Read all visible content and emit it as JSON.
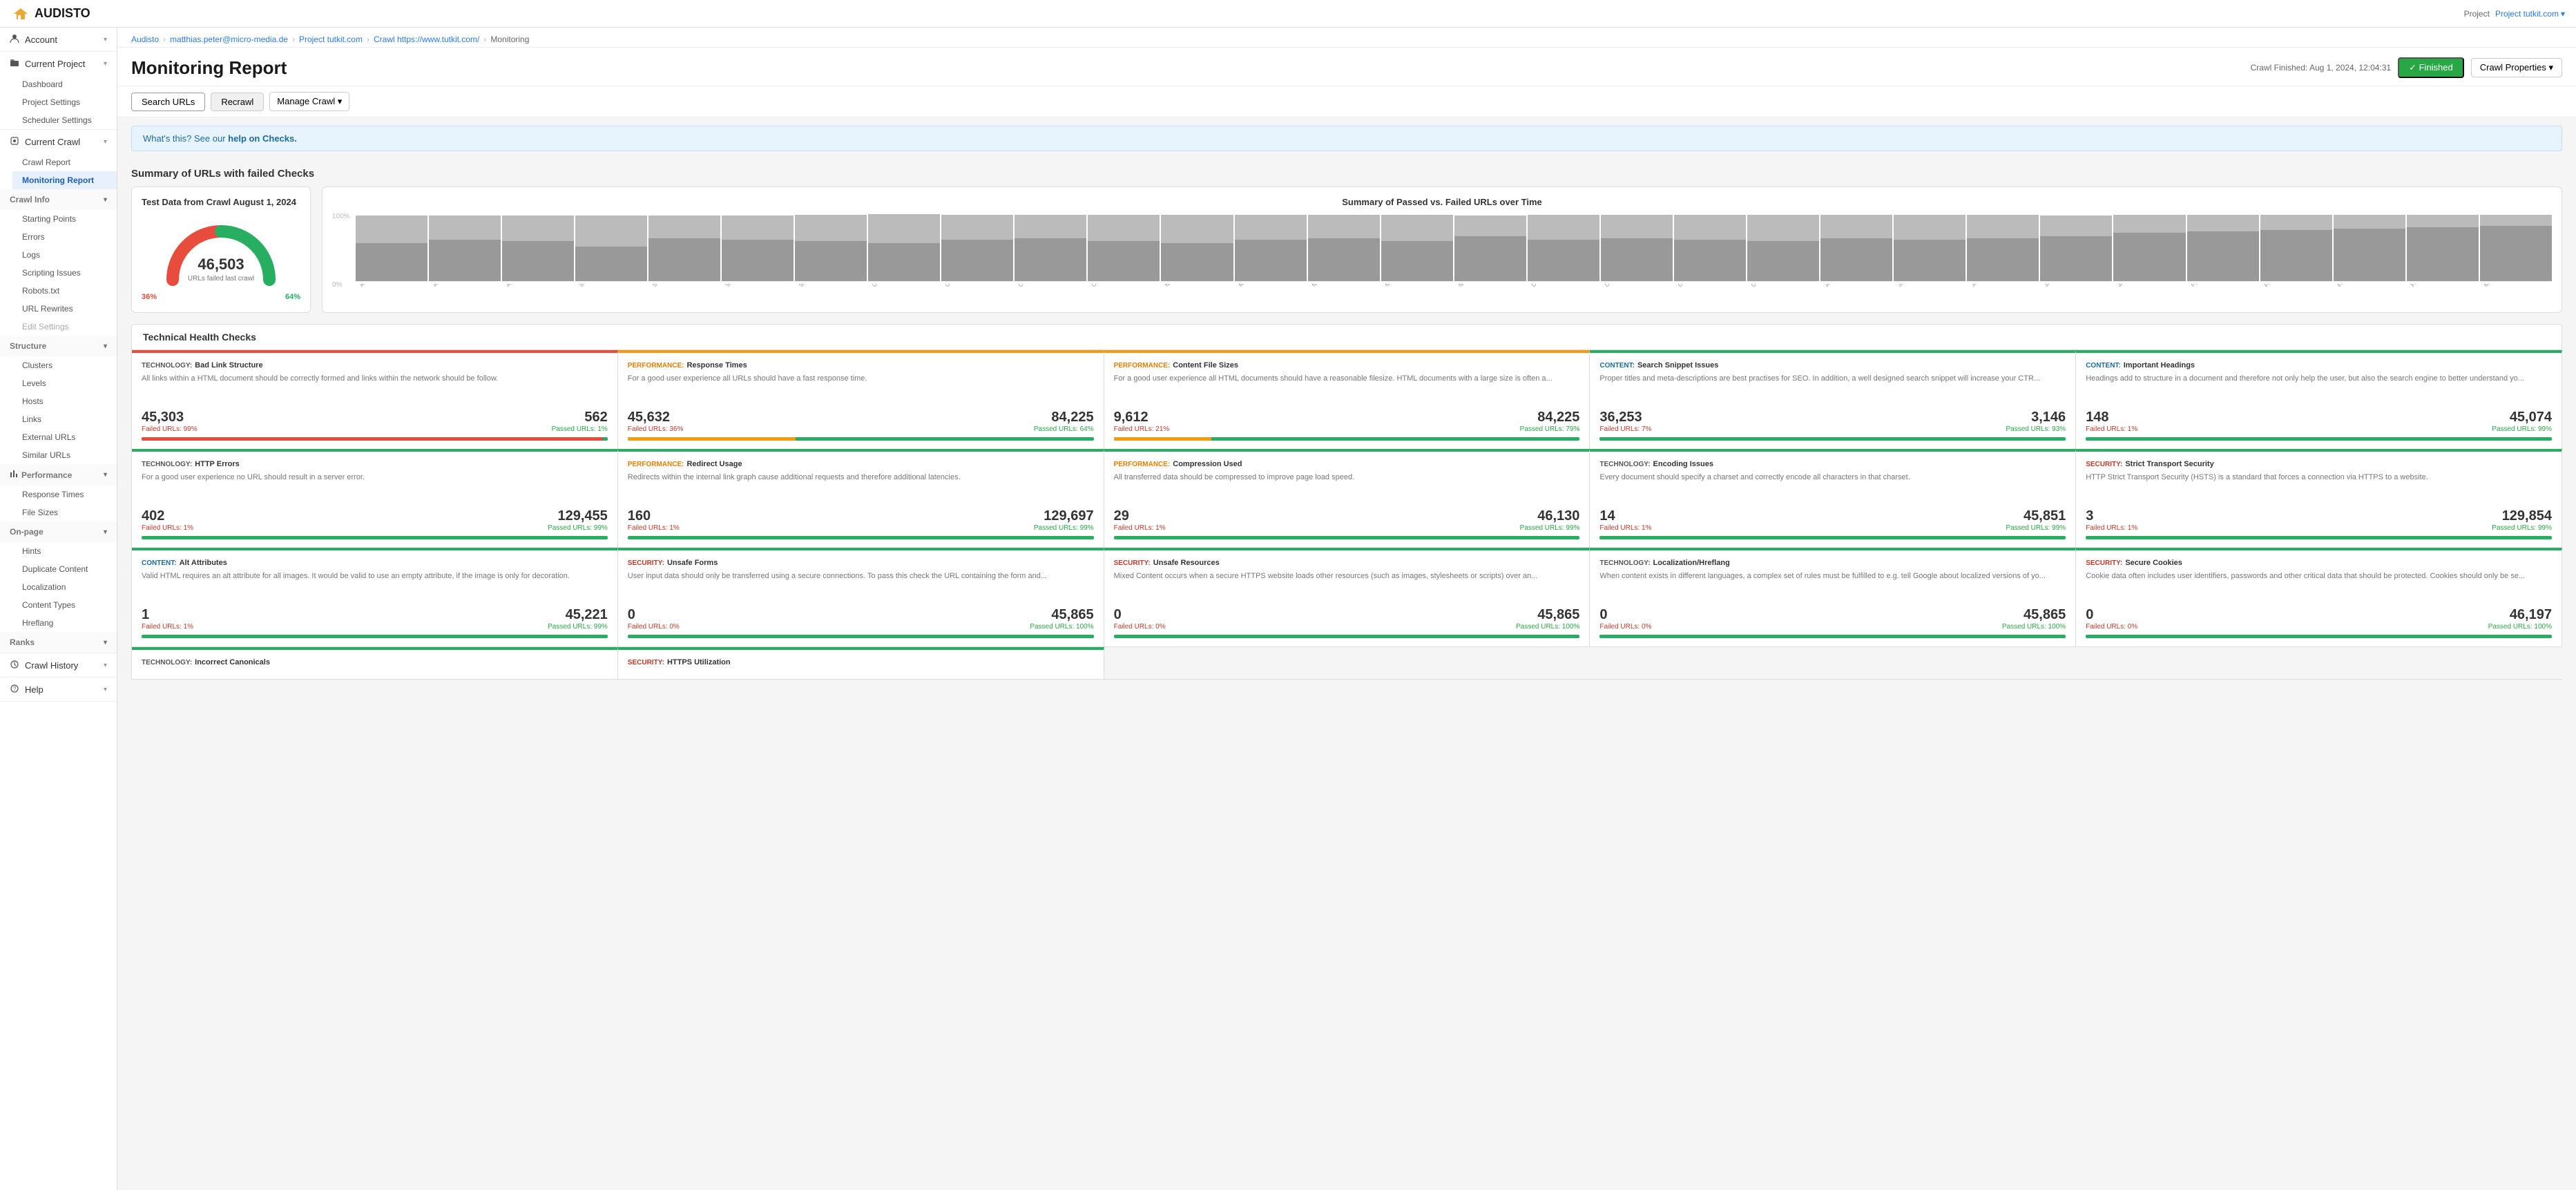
{
  "topNav": {
    "logo": "AUDISTO",
    "projectLabel": "Project",
    "projectName": "Project tutkit.com",
    "projectDropdown": "▾"
  },
  "breadcrumb": [
    {
      "label": "Audisto",
      "link": true
    },
    {
      "label": "matthias.peter@micro-media.de",
      "link": true
    },
    {
      "label": "Project tutkit.com",
      "link": true
    },
    {
      "label": "Crawl https://www.tutkit.com/",
      "link": true
    },
    {
      "label": "Monitoring",
      "link": false
    }
  ],
  "page": {
    "title": "Monitoring Report",
    "crawlFinished": "Crawl Finished: Aug 1, 2024, 12:04:31",
    "finishedBadge": "✓ Finished",
    "crawlPropsBtn": "Crawl Properties ▾"
  },
  "toolbar": {
    "searchUrls": "Search URLs",
    "recrawl": "Recrawl",
    "manageCrawl": "Manage Crawl ▾"
  },
  "infoBanner": {
    "text": "What's this? See our ",
    "linkText": "help on Checks.",
    "suffix": ""
  },
  "summary": {
    "sectionTitle": "Summary of URLs with failed Checks",
    "gaugeCard": {
      "title": "Test Data from Crawl August 1, 2024",
      "number": "46,503",
      "label": "URLs failed last crawl",
      "pctLeft": "36%",
      "pctRight": "64%",
      "redDeg": 130,
      "greenDeg": 360
    },
    "barChart": {
      "title": "Summary of Passed vs. Failed URLs over Time",
      "yLabels": [
        "100%",
        "0%"
      ],
      "bars": [
        {
          "label": "Aug 16",
          "fail": 55,
          "pass": 40
        },
        {
          "label": "Aug 23",
          "fail": 60,
          "pass": 35
        },
        {
          "label": "Aug 30",
          "fail": 58,
          "pass": 37
        },
        {
          "label": "Sep 6",
          "fail": 50,
          "pass": 45
        },
        {
          "label": "Sep 13",
          "fail": 62,
          "pass": 33
        },
        {
          "label": "Sep 20",
          "fail": 60,
          "pass": 35
        },
        {
          "label": "Sep 27",
          "fail": 58,
          "pass": 38
        },
        {
          "label": "Oct 4",
          "fail": 55,
          "pass": 42
        },
        {
          "label": "Oct 11",
          "fail": 60,
          "pass": 36
        },
        {
          "label": "Oct 18",
          "fail": 62,
          "pass": 34
        },
        {
          "label": "Oct 25",
          "fail": 58,
          "pass": 38
        },
        {
          "label": "Nov 1",
          "fail": 55,
          "pass": 41
        },
        {
          "label": "Nov 8",
          "fail": 60,
          "pass": 36
        },
        {
          "label": "Nov 15",
          "fail": 62,
          "pass": 34
        },
        {
          "label": "Nov 22",
          "fail": 58,
          "pass": 38
        },
        {
          "label": "Nov 29",
          "fail": 65,
          "pass": 30
        },
        {
          "label": "Dec 6",
          "fail": 60,
          "pass": 36
        },
        {
          "label": "Dec 13",
          "fail": 62,
          "pass": 34
        },
        {
          "label": "Dec 20",
          "fail": 60,
          "pass": 36
        },
        {
          "label": "Dec 27",
          "fail": 58,
          "pass": 38
        },
        {
          "label": "Jan 3",
          "fail": 62,
          "pass": 34
        },
        {
          "label": "Jan 10",
          "fail": 60,
          "pass": 36
        },
        {
          "label": "Jan 17",
          "fail": 62,
          "pass": 34
        },
        {
          "label": "Jan 24",
          "fail": 65,
          "pass": 30
        },
        {
          "label": "Jan 31",
          "fail": 70,
          "pass": 26
        },
        {
          "label": "Feb 7",
          "fail": 72,
          "pass": 24
        },
        {
          "label": "Feb 14",
          "fail": 74,
          "pass": 22
        },
        {
          "label": "Feb 21",
          "fail": 76,
          "pass": 20
        },
        {
          "label": "Feb 28",
          "fail": 78,
          "pass": 18
        },
        {
          "label": "Mar 7",
          "fail": 80,
          "pass": 16
        }
      ]
    }
  },
  "techHealth": {
    "sectionTitle": "Technical Health Checks",
    "cards": [
      {
        "category": "TECHNOLOGY",
        "categoryClass": "cat-tech",
        "name": "Bad Link Structure",
        "desc": "All links within a HTML document should be correctly formed and links within the network should be follow.",
        "failCount": "45,303",
        "passCount": "562",
        "failPct": "Failed URLs: 99%",
        "passPct": "Passed URLs: 1%",
        "failBar": 99,
        "statusColor": "red"
      },
      {
        "category": "PERFORMANCE",
        "categoryClass": "cat-perf",
        "name": "Response Times",
        "desc": "For a good user experience all URLs should have a fast response time.",
        "failCount": "45,632",
        "passCount": "84,225",
        "failPct": "Failed URLs: 36%",
        "passPct": "Passed URLs: 64%",
        "failBar": 36,
        "statusColor": "yellow"
      },
      {
        "category": "PERFORMANCE",
        "categoryClass": "cat-perf",
        "name": "Content File Sizes",
        "desc": "For a good user experience all HTML documents should have a reasonable filesize. HTML documents with a large size is often a...",
        "failCount": "9,612",
        "passCount": "84,225",
        "failPct": "Failed URLs: 21%",
        "passPct": "Passed URLs: 79%",
        "failBar": 21,
        "statusColor": "yellow"
      },
      {
        "category": "CONTENT",
        "categoryClass": "cat-content",
        "name": "Search Snippet Issues",
        "desc": "Proper titles and meta-descriptions are best practises for SEO. In addition, a well designed search snippet will increase your CTR...",
        "failCount": "36,253",
        "passCount": "3,146",
        "failPct": "Failed URLs: 7%",
        "passPct": "Passed URLs: 93%",
        "failBar": 7,
        "statusColor": "green"
      },
      {
        "category": "CONTENT",
        "categoryClass": "cat-content",
        "name": "Important Headings",
        "desc": "Headings add to structure in a document and therefore not only help the user, but also the search engine to better understand yo...",
        "failCount": "148",
        "passCount": "45,074",
        "failPct": "Failed URLs: 1%",
        "passPct": "Passed URLs: 99%",
        "failBar": 1,
        "statusColor": "green"
      },
      {
        "category": "TECHNOLOGY",
        "categoryClass": "cat-tech",
        "name": "HTTP Errors",
        "desc": "For a good user experience no URL should result in a server error.",
        "failCount": "402",
        "passCount": "129,455",
        "failPct": "Failed URLs: 1%",
        "passPct": "Passed URLs: 99%",
        "failBar": 1,
        "statusColor": "green"
      },
      {
        "category": "PERFORMANCE",
        "categoryClass": "cat-perf",
        "name": "Redirect Usage",
        "desc": "Redirects within the internal link graph cause additional requests and therefore additional latencies.",
        "failCount": "160",
        "passCount": "129,697",
        "failPct": "Failed URLs: 1%",
        "passPct": "Passed URLs: 99%",
        "failBar": 1,
        "statusColor": "green"
      },
      {
        "category": "PERFORMANCE",
        "categoryClass": "cat-perf",
        "name": "Compression Used",
        "desc": "All transferred data should be compressed to improve page load speed.",
        "failCount": "29",
        "passCount": "46,130",
        "failPct": "Failed URLs: 1%",
        "passPct": "Passed URLs: 99%",
        "failBar": 1,
        "statusColor": "green"
      },
      {
        "category": "TECHNOLOGY",
        "categoryClass": "cat-tech",
        "name": "Encoding Issues",
        "desc": "Every document should specify a charset and correctly encode all characters in that charset.",
        "failCount": "14",
        "passCount": "45,851",
        "failPct": "Failed URLs: 1%",
        "passPct": "Passed URLs: 99%",
        "failBar": 1,
        "statusColor": "green"
      },
      {
        "category": "SECURITY",
        "categoryClass": "cat-security",
        "name": "Strict Transport Security",
        "desc": "HTTP Strict Transport Security (HSTS) is a standard that forces a connection via HTTPS to a website.",
        "failCount": "3",
        "passCount": "129,854",
        "failPct": "Failed URLs: 1%",
        "passPct": "Passed URLs: 99%",
        "failBar": 1,
        "statusColor": "green"
      },
      {
        "category": "CONTENT",
        "categoryClass": "cat-content",
        "name": "Alt Attributes",
        "desc": "Valid HTML requires an alt attribute for all images. It would be valid to use an empty attribute, if the image is only for decoration.",
        "failCount": "1",
        "passCount": "45,221",
        "failPct": "Failed URLs: 1%",
        "passPct": "Passed URLs: 99%",
        "failBar": 1,
        "statusColor": "green"
      },
      {
        "category": "SECURITY",
        "categoryClass": "cat-security",
        "name": "Unsafe Forms",
        "desc": "User input data should only be transferred using a secure connections. To pass this check the URL containing the form and...",
        "failCount": "0",
        "passCount": "45,865",
        "failPct": "Failed URLs: 0%",
        "passPct": "Passed URLs: 100%",
        "failBar": 0,
        "statusColor": "green"
      },
      {
        "category": "SECURITY",
        "categoryClass": "cat-security",
        "name": "Unsafe Resources",
        "desc": "Mixed Content occurs when a secure HTTPS website loads other resources (such as images, stylesheets or scripts) over an...",
        "failCount": "0",
        "passCount": "45,865",
        "failPct": "Failed URLs: 0%",
        "passPct": "Passed URLs: 100%",
        "failBar": 0,
        "statusColor": "green"
      },
      {
        "category": "TECHNOLOGY",
        "categoryClass": "cat-tech",
        "name": "Localization/Hreflang",
        "desc": "When content exists in different languages, a complex set of rules must be fulfilled to e.g. tell Google about localized versions of yo...",
        "failCount": "0",
        "passCount": "45,865",
        "failPct": "Failed URLs: 0%",
        "passPct": "Passed URLs: 100%",
        "failBar": 0,
        "statusColor": "green"
      },
      {
        "category": "SECURITY",
        "categoryClass": "cat-security",
        "name": "Secure Cookies",
        "desc": "Cookie data often includes user identifiers, passwords and other critical data that should be protected. Cookies should only be se...",
        "failCount": "0",
        "passCount": "46,197",
        "failPct": "Failed URLs: 0%",
        "passPct": "Passed URLs: 100%",
        "failBar": 0,
        "statusColor": "green"
      }
    ],
    "bottomCards": [
      {
        "category": "TECHNOLOGY",
        "categoryClass": "cat-tech",
        "name": "Incorrect Canonicals",
        "desc": "",
        "failCount": "",
        "passCount": "",
        "failPct": "",
        "passPct": "",
        "failBar": 0,
        "statusColor": "green"
      },
      {
        "category": "SECURITY",
        "categoryClass": "cat-security",
        "name": "HTTPS Utilization",
        "desc": "",
        "failCount": "",
        "passCount": "",
        "failPct": "",
        "passPct": "",
        "failBar": 0,
        "statusColor": "green"
      }
    ]
  },
  "sidebar": {
    "sections": [
      {
        "type": "item",
        "label": "Account",
        "icon": "person",
        "hasChevron": true
      },
      {
        "type": "item",
        "label": "Current Project",
        "icon": "folder",
        "hasChevron": true,
        "active": false
      },
      {
        "type": "subgroup",
        "items": [
          {
            "label": "Dashboard",
            "active": false
          },
          {
            "label": "Project Settings",
            "active": false
          },
          {
            "label": "Scheduler Settings",
            "active": false
          }
        ]
      },
      {
        "type": "item",
        "label": "Current Crawl",
        "icon": "spider",
        "hasChevron": true
      },
      {
        "type": "subgroup",
        "items": [
          {
            "label": "Crawl Report",
            "active": false
          },
          {
            "label": "Monitoring Report",
            "active": true
          }
        ]
      },
      {
        "type": "groupHeader",
        "label": "Crawl Info",
        "hasChevron": true
      },
      {
        "type": "subgroup",
        "items": [
          {
            "label": "Starting Points",
            "active": false
          },
          {
            "label": "Errors",
            "active": false
          },
          {
            "label": "Logs",
            "active": false
          },
          {
            "label": "Scripting Issues",
            "active": false
          },
          {
            "label": "Robots.txt",
            "active": false
          },
          {
            "label": "URL Rewrites",
            "active": false
          },
          {
            "label": "Edit Settings",
            "active": false,
            "muted": true
          }
        ]
      },
      {
        "type": "groupHeader",
        "label": "Structure",
        "hasChevron": true
      },
      {
        "type": "subgroup",
        "items": [
          {
            "label": "Clusters",
            "active": false
          },
          {
            "label": "Levels",
            "active": false
          },
          {
            "label": "Hosts",
            "active": false
          },
          {
            "label": "Links",
            "active": false
          },
          {
            "label": "External URLs",
            "active": false
          },
          {
            "label": "Similar URLs",
            "active": false
          }
        ]
      },
      {
        "type": "groupHeader",
        "label": "Performance",
        "hasChevron": true,
        "icon": "chart"
      },
      {
        "type": "subgroup",
        "items": [
          {
            "label": "Response Times",
            "active": false
          },
          {
            "label": "File Sizes",
            "active": false
          }
        ]
      },
      {
        "type": "groupHeader",
        "label": "On-page",
        "hasChevron": true
      },
      {
        "type": "subgroup",
        "items": [
          {
            "label": "Hints",
            "active": false
          },
          {
            "label": "Duplicate Content",
            "active": false
          },
          {
            "label": "Localization",
            "active": false
          },
          {
            "label": "Content Types",
            "active": false
          },
          {
            "label": "Hreflang",
            "active": false
          }
        ]
      },
      {
        "type": "groupHeader",
        "label": "Ranks",
        "hasChevron": true
      },
      {
        "type": "item",
        "label": "Crawl History",
        "icon": "history",
        "hasChevron": true
      },
      {
        "type": "item",
        "label": "Help",
        "icon": "help",
        "hasChevron": true
      }
    ]
  }
}
